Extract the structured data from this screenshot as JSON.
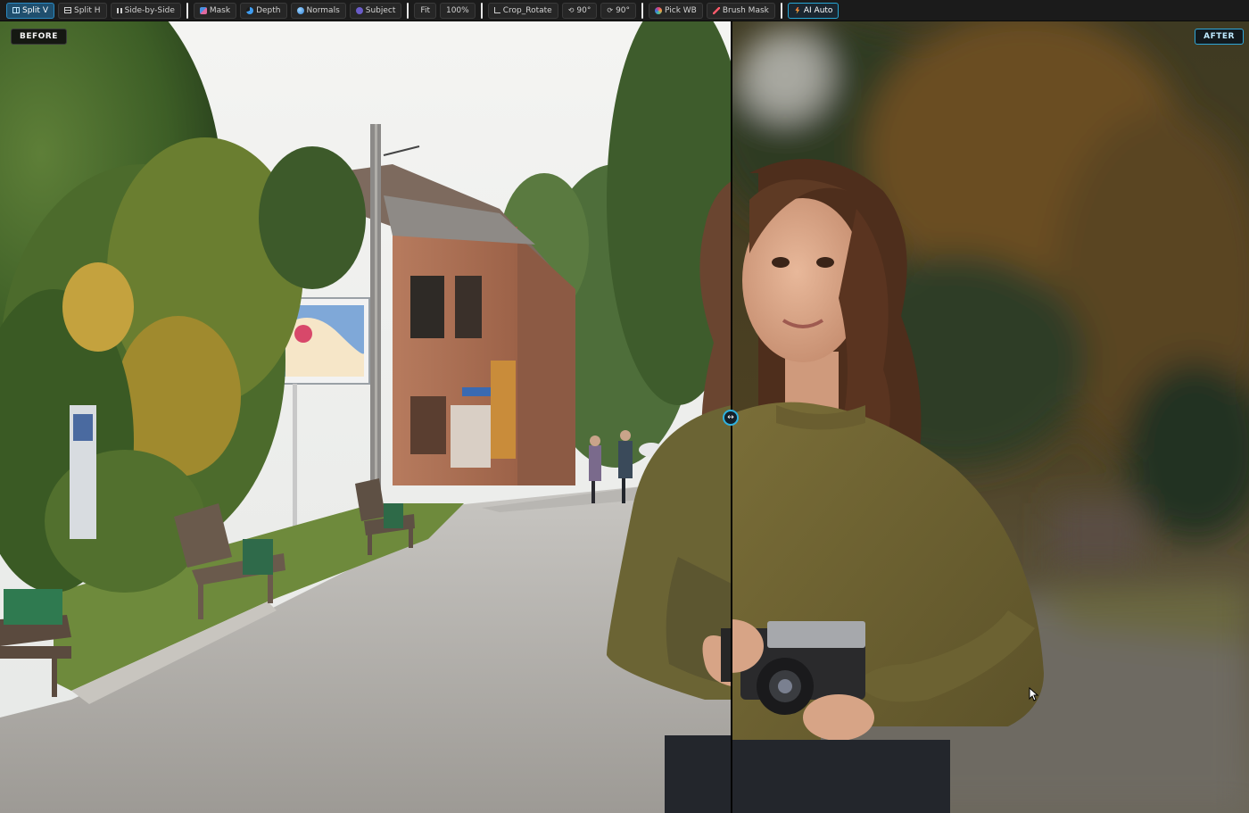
{
  "toolbar": {
    "groups": [
      [
        {
          "label": "Split V",
          "icon": "split-vertical-icon",
          "active": true
        },
        {
          "label": "Split H",
          "icon": "split-horizontal-icon",
          "active": false
        },
        {
          "label": "Side-by-Side",
          "icon": "side-by-side-icon",
          "active": false
        }
      ],
      [
        {
          "label": "Mask",
          "icon": "mask-icon"
        },
        {
          "label": "Depth",
          "icon": "depth-icon"
        },
        {
          "label": "Normals",
          "icon": "normals-icon"
        },
        {
          "label": "Subject",
          "icon": "subject-icon"
        }
      ],
      [
        {
          "label": "Fit"
        },
        {
          "label": "100%"
        }
      ],
      [
        {
          "label": "Crop_Rotate",
          "icon": "crop-icon"
        },
        {
          "label": "90°",
          "icon": "rotate-left-icon"
        },
        {
          "label": "90°",
          "icon": "rotate-right-icon"
        }
      ],
      [
        {
          "label": "Pick WB",
          "icon": "white-balance-icon"
        },
        {
          "label": "Brush Mask",
          "icon": "brush-icon"
        }
      ],
      [
        {
          "label": "AI Auto",
          "icon": "ai-auto-icon"
        }
      ]
    ]
  },
  "viewer": {
    "before_label": "BEFORE",
    "after_label": "AFTER",
    "split_handle_glyph": "↔",
    "accent_color": "#2fb2e0"
  }
}
